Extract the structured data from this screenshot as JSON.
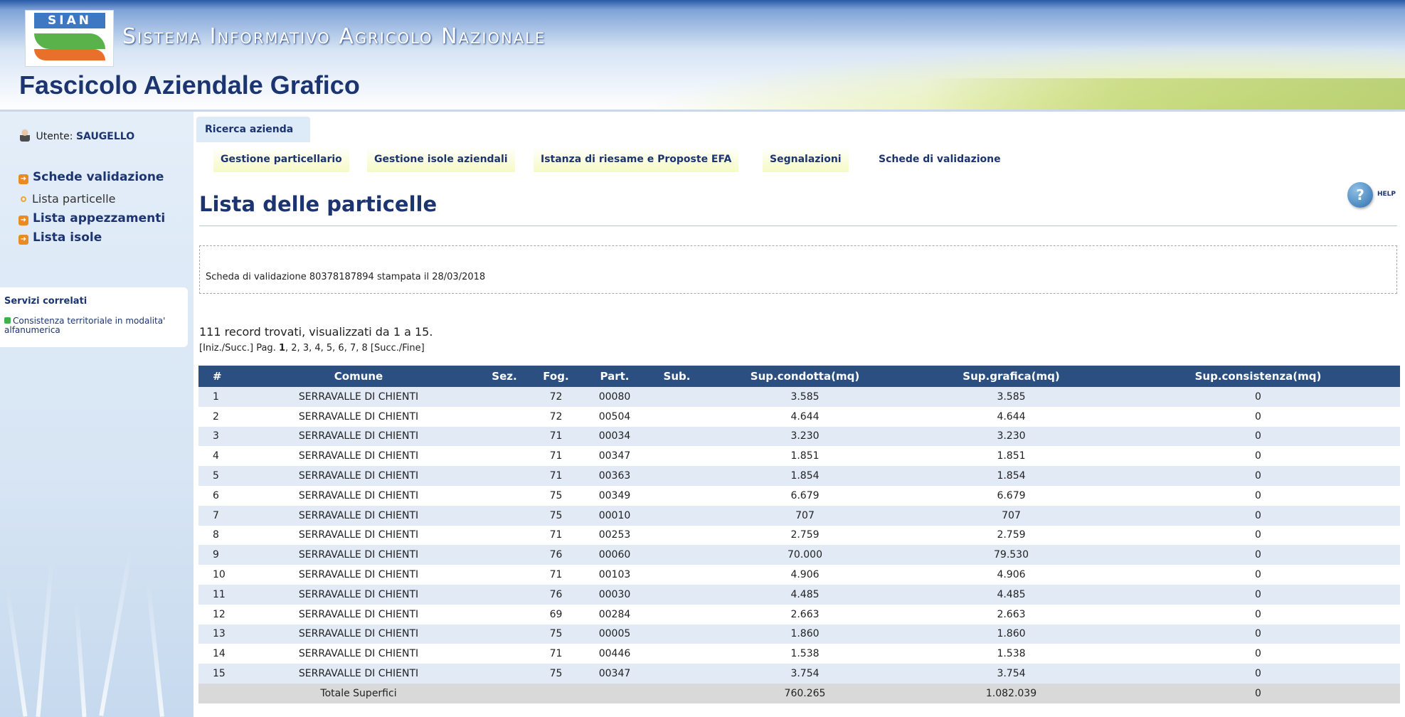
{
  "header": {
    "logo_text": "SIAN",
    "system_title": "Sistema Informativo Agricolo Nazionale",
    "app_title": "Fascicolo Aziendale Grafico"
  },
  "sidebar": {
    "user_label": "Utente:",
    "user_name": "SAUGELLO",
    "links": [
      {
        "label": "Schede validazione"
      },
      {
        "label": "Lista particelle"
      },
      {
        "label": "Lista appezzamenti"
      },
      {
        "label": "Lista isole"
      }
    ],
    "servizi": {
      "title": "Servizi correlati",
      "item": "Consistenza territoriale in modalita' alfanumerica"
    }
  },
  "nav": {
    "search_button": "Ricerca azienda",
    "tabs": [
      {
        "label": "Gestione particellario"
      },
      {
        "label": "Gestione isole aziendali"
      },
      {
        "label": "Istanza di riesame e Proposte EFA"
      },
      {
        "label": "Segnalazioni"
      },
      {
        "label": "Schede di validazione"
      }
    ]
  },
  "main": {
    "title": "Lista delle particelle",
    "help_label": "HELP",
    "scheda_text": "Scheda di validazione 80378187894 stampata il 28/03/2018",
    "records_text": "111 record trovati, visualizzati da 1 a 15.",
    "pager": {
      "start": "[Iniz./Succ.] Pag. ",
      "current": "1",
      "rest": ", 2, 3, 4, 5, 6, 7, 8 [Succ./Fine]"
    }
  },
  "table": {
    "headers": [
      "#",
      "Comune",
      "Sez.",
      "Fog.",
      "Part.",
      "Sub.",
      "Sup.condotta(mq)",
      "Sup.grafica(mq)",
      "Sup.consistenza(mq)"
    ],
    "rows": [
      {
        "n": "1",
        "comune": "SERRAVALLE DI CHIENTI",
        "sez": "",
        "fog": "72",
        "part": "00080",
        "sub": "",
        "condotta": "3.585",
        "grafica": "3.585",
        "consistenza": "0"
      },
      {
        "n": "2",
        "comune": "SERRAVALLE DI CHIENTI",
        "sez": "",
        "fog": "72",
        "part": "00504",
        "sub": "",
        "condotta": "4.644",
        "grafica": "4.644",
        "consistenza": "0"
      },
      {
        "n": "3",
        "comune": "SERRAVALLE DI CHIENTI",
        "sez": "",
        "fog": "71",
        "part": "00034",
        "sub": "",
        "condotta": "3.230",
        "grafica": "3.230",
        "consistenza": "0"
      },
      {
        "n": "4",
        "comune": "SERRAVALLE DI CHIENTI",
        "sez": "",
        "fog": "71",
        "part": "00347",
        "sub": "",
        "condotta": "1.851",
        "grafica": "1.851",
        "consistenza": "0"
      },
      {
        "n": "5",
        "comune": "SERRAVALLE DI CHIENTI",
        "sez": "",
        "fog": "71",
        "part": "00363",
        "sub": "",
        "condotta": "1.854",
        "grafica": "1.854",
        "consistenza": "0"
      },
      {
        "n": "6",
        "comune": "SERRAVALLE DI CHIENTI",
        "sez": "",
        "fog": "75",
        "part": "00349",
        "sub": "",
        "condotta": "6.679",
        "grafica": "6.679",
        "consistenza": "0"
      },
      {
        "n": "7",
        "comune": "SERRAVALLE DI CHIENTI",
        "sez": "",
        "fog": "75",
        "part": "00010",
        "sub": "",
        "condotta": "707",
        "grafica": "707",
        "consistenza": "0"
      },
      {
        "n": "8",
        "comune": "SERRAVALLE DI CHIENTI",
        "sez": "",
        "fog": "71",
        "part": "00253",
        "sub": "",
        "condotta": "2.759",
        "grafica": "2.759",
        "consistenza": "0"
      },
      {
        "n": "9",
        "comune": "SERRAVALLE DI CHIENTI",
        "sez": "",
        "fog": "76",
        "part": "00060",
        "sub": "",
        "condotta": "70.000",
        "grafica": "79.530",
        "consistenza": "0"
      },
      {
        "n": "10",
        "comune": "SERRAVALLE DI CHIENTI",
        "sez": "",
        "fog": "71",
        "part": "00103",
        "sub": "",
        "condotta": "4.906",
        "grafica": "4.906",
        "consistenza": "0"
      },
      {
        "n": "11",
        "comune": "SERRAVALLE DI CHIENTI",
        "sez": "",
        "fog": "76",
        "part": "00030",
        "sub": "",
        "condotta": "4.485",
        "grafica": "4.485",
        "consistenza": "0"
      },
      {
        "n": "12",
        "comune": "SERRAVALLE DI CHIENTI",
        "sez": "",
        "fog": "69",
        "part": "00284",
        "sub": "",
        "condotta": "2.663",
        "grafica": "2.663",
        "consistenza": "0"
      },
      {
        "n": "13",
        "comune": "SERRAVALLE DI CHIENTI",
        "sez": "",
        "fog": "75",
        "part": "00005",
        "sub": "",
        "condotta": "1.860",
        "grafica": "1.860",
        "consistenza": "0"
      },
      {
        "n": "14",
        "comune": "SERRAVALLE DI CHIENTI",
        "sez": "",
        "fog": "71",
        "part": "00446",
        "sub": "",
        "condotta": "1.538",
        "grafica": "1.538",
        "consistenza": "0"
      },
      {
        "n": "15",
        "comune": "SERRAVALLE DI CHIENTI",
        "sez": "",
        "fog": "75",
        "part": "00347",
        "sub": "",
        "condotta": "3.754",
        "grafica": "3.754",
        "consistenza": "0"
      }
    ],
    "totals": {
      "label": "Totale Superfici",
      "condotta": "760.265",
      "grafica": "1.082.039",
      "consistenza": "0"
    }
  },
  "colors": {
    "header_dark": "#2a5aa8",
    "title_navy": "#1c3570",
    "table_header": "#2b4f80",
    "row_alt": "#e1eaf5",
    "tab_yellow": "#f5fbc4",
    "sidebar_bg": "#d7e5f4"
  }
}
